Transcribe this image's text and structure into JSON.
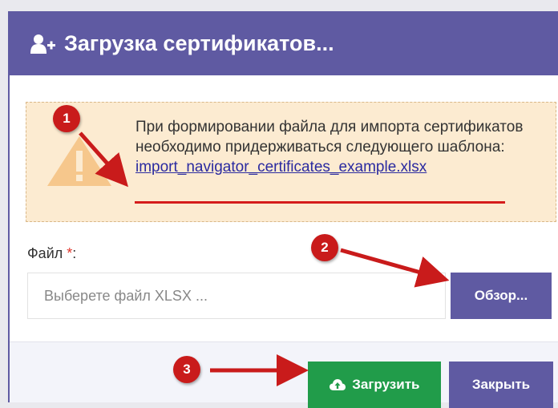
{
  "dialog": {
    "title": "Загрузка сертификатов...",
    "title_icon": "user-plus-icon",
    "notice": {
      "icon": "warning-icon",
      "text": "При формировании файла для импорта сертификатов необходимо придерживаться следующего шаблона:",
      "link": "import_navigator_certificates_example.xlsx"
    },
    "file_field": {
      "label": "Файл",
      "required_mark": "*",
      "label_suffix": ":",
      "placeholder": "Выберете файл XLSX ...",
      "browse_label": "Обзор..."
    },
    "footer": {
      "upload_label": "Загрузить",
      "upload_icon": "cloud-upload-icon",
      "close_label": "Закрыть"
    }
  },
  "annotations": {
    "markers": [
      "1",
      "2",
      "3"
    ]
  },
  "colors": {
    "primary": "#5f5aa2",
    "success": "#219c4a",
    "notice_bg": "#fcebd1",
    "annotation": "#c91b1b"
  }
}
